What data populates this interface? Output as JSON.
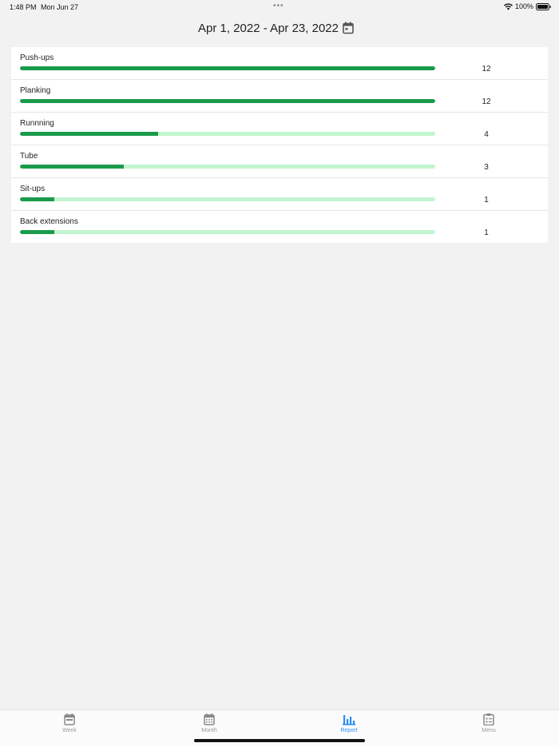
{
  "status_bar": {
    "time": "1:48 PM",
    "date": "Mon Jun 27",
    "dots": "•••",
    "battery": "100%"
  },
  "header": {
    "date_range": "Apr 1, 2022 - Apr 23, 2022",
    "calendar_icon": "calendar-icon"
  },
  "report": {
    "max_count": 12,
    "items": [
      {
        "name": "Push-ups",
        "count": "12",
        "value": 12
      },
      {
        "name": "Planking",
        "count": "12",
        "value": 12
      },
      {
        "name": "Runnning",
        "count": "4",
        "value": 4
      },
      {
        "name": "Tube",
        "count": "3",
        "value": 3
      },
      {
        "name": "Sit-ups",
        "count": "1",
        "value": 1
      },
      {
        "name": "Back extensions",
        "count": "1",
        "value": 1
      }
    ]
  },
  "tabs": [
    {
      "label": "Week",
      "icon": "calendar-week-icon",
      "active": false
    },
    {
      "label": "Month",
      "icon": "calendar-month-icon",
      "active": false
    },
    {
      "label": "Report",
      "icon": "bar-chart-icon",
      "active": true
    },
    {
      "label": "Menu",
      "icon": "clipboard-list-icon",
      "active": false
    }
  ],
  "colors": {
    "bar_fill": "#1a9b4b",
    "bar_track": "#c2f5cf",
    "tab_active": "#2c8ef8",
    "tab_inactive": "#999999"
  }
}
